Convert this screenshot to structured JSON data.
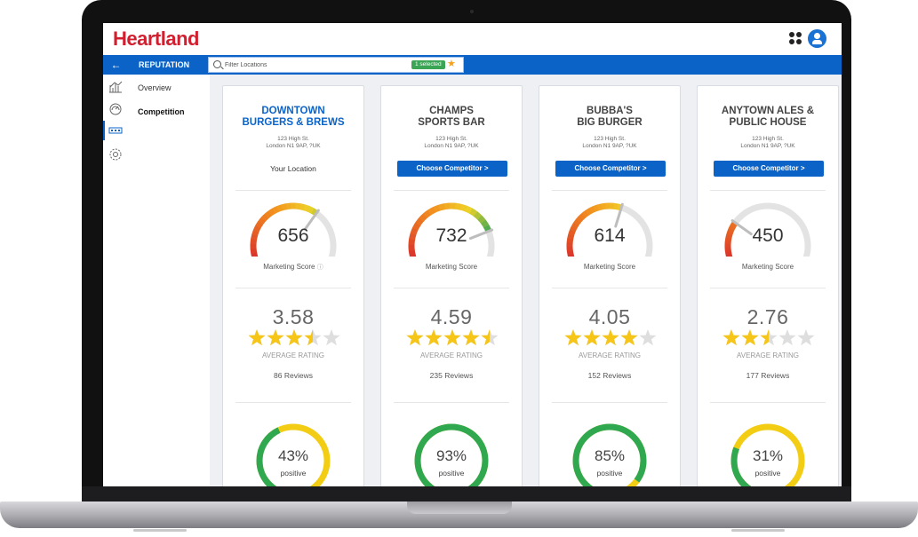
{
  "app": {
    "logo": "Heartland"
  },
  "toolbar": {
    "back_icon": "arrow-left-icon",
    "section_title": "REPUTATION",
    "filter_placeholder": "Filter Locations",
    "selected_badge": "1 selected",
    "favorite_icon": "star-icon"
  },
  "header_icons": {
    "apps": "apps-grid-icon",
    "user": "user-avatar-icon"
  },
  "nav": {
    "items": [
      {
        "label": "Overview",
        "active": false
      },
      {
        "label": "Competition",
        "active": true
      }
    ],
    "rail_icons": [
      "chart-icon",
      "gauge-icon",
      "competition-icon",
      "settings-icon"
    ]
  },
  "colors": {
    "brand_red": "#d11f2f",
    "brand_blue": "#0b63c8",
    "positive_green": "#3aa655",
    "star_gold": "#f5c518"
  },
  "cards": [
    {
      "name_line1": "DOWNTOWN",
      "name_line2": "BURGERS & BREWS",
      "addr_line1": "123 High St.",
      "addr_line2": "London N1 9AP, ?UK",
      "your_location": "Your Location",
      "choose_label": "",
      "score": "656",
      "score_label": "Marketing Score",
      "rating": "3.58",
      "stars": 3.5,
      "avg_label": "AVERAGE RATING",
      "reviews": "86 Reviews",
      "positive_pct_value": 43,
      "positive_pct": "43%",
      "positive_label": "positive"
    },
    {
      "name_line1": "CHAMPS",
      "name_line2": "SPORTS BAR",
      "addr_line1": "123 High St.",
      "addr_line2": "London N1 9AP, ?UK",
      "your_location": "",
      "choose_label": "Choose Competitor >",
      "score": "732",
      "score_label": "Marketing Score",
      "rating": "4.59",
      "stars": 4.5,
      "avg_label": "AVERAGE RATING",
      "reviews": "235 Reviews",
      "positive_pct_value": 93,
      "positive_pct": "93%",
      "positive_label": "positive"
    },
    {
      "name_line1": "BUBBA'S",
      "name_line2": "BIG BURGER",
      "addr_line1": "123 High St.",
      "addr_line2": "London N1 9AP, ?UK",
      "your_location": "",
      "choose_label": "Choose Competitor >",
      "score": "614",
      "score_label": "Marketing Score",
      "rating": "4.05",
      "stars": 4,
      "avg_label": "AVERAGE RATING",
      "reviews": "152 Reviews",
      "positive_pct_value": 85,
      "positive_pct": "85%",
      "positive_label": "positive"
    },
    {
      "name_line1": "ANYTOWN ALES &",
      "name_line2": "PUBLIC HOUSE",
      "addr_line1": "123 High St.",
      "addr_line2": "London N1 9AP, ?UK",
      "your_location": "",
      "choose_label": "Choose Competitor >",
      "score": "450",
      "score_label": "Marketing Score",
      "rating": "2.76",
      "stars": 2.5,
      "avg_label": "AVERAGE RATING",
      "reviews": "177 Reviews",
      "positive_pct_value": 31,
      "positive_pct": "31%",
      "positive_label": "positive"
    }
  ]
}
